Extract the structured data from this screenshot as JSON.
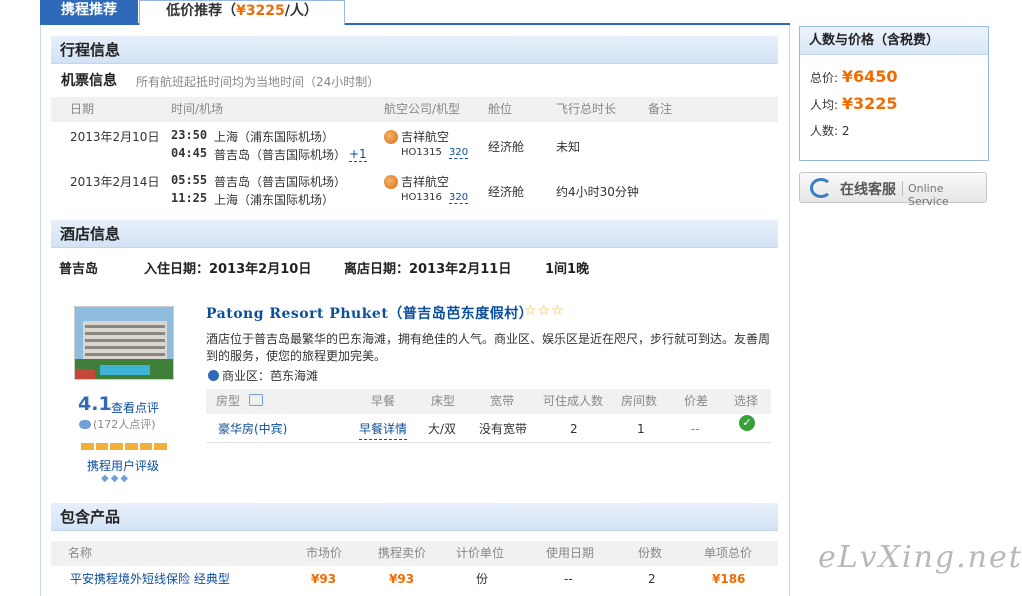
{
  "tabs": [
    {
      "label": "携程推荐"
    },
    {
      "label_prefix": "低价推荐（",
      "price": "¥3225",
      "label_suffix": "/人）"
    }
  ],
  "itinerary": {
    "title": "行程信息",
    "flight_title": "机票信息",
    "flight_note": "所有航班起抵时间均为当地时间（24小时制）",
    "headers": [
      "日期",
      "时间/机场",
      "航空公司/机型",
      "舱位",
      "飞行总时长",
      "备注"
    ],
    "flights": [
      {
        "date": "2013年2月10日",
        "dep_time": "23:50",
        "dep_airport": "上海（浦东国际机场）",
        "arr_time": "04:45",
        "arr_airport": "普吉岛（普吉国际机场）",
        "day_offset": "+1",
        "airline": "吉祥航空",
        "flight_no": "HO1315",
        "aircraft": "320",
        "cabin": "经济舱",
        "duration": "未知"
      },
      {
        "date": "2013年2月14日",
        "dep_time": "05:55",
        "dep_airport": "普吉岛（普吉国际机场）",
        "arr_time": "11:25",
        "arr_airport": "上海（浦东国际机场）",
        "day_offset": "",
        "airline": "吉祥航空",
        "flight_no": "HO1316",
        "aircraft": "320",
        "cabin": "经济舱",
        "duration": "约4小时30分钟"
      }
    ]
  },
  "hotel": {
    "title": "酒店信息",
    "city": "普吉岛",
    "checkin": "入住日期：2013年2月10日",
    "checkout": "离店日期：2013年2月11日",
    "rooms_nights": "1间1晚",
    "name": "Patong Resort Phuket（普吉岛芭东度假村）",
    "stars": "☆☆☆",
    "description": "酒店位于普吉岛最繁华的巴东海滩，拥有绝佳的人气。商业区、娱乐区是近在咫尺，步行就可到达。友善周到的服务，使您的旅程更加完美。",
    "business_area": "商业区：芭东海滩",
    "score": "4.1",
    "score_link": "查看点评",
    "review_count": "(172人点评)",
    "rating_label": "携程用户评级",
    "rating_diamonds": "◆◆◆",
    "room_headers": [
      "房型",
      "早餐",
      "床型",
      "宽带",
      "可住成人数",
      "房间数",
      "价差",
      "选择"
    ],
    "room": {
      "type": "豪华房(中宾)",
      "breakfast": "早餐详情",
      "bed": "大/双",
      "broadband": "没有宽带",
      "adults": "2",
      "rooms": "1",
      "price_diff": "--",
      "select": "✓"
    }
  },
  "products": {
    "title": "包含产品",
    "headers": [
      "名称",
      "市场价",
      "携程卖价",
      "计价单位",
      "使用日期",
      "份数",
      "单项总价"
    ],
    "rows": [
      {
        "name": "平安携程境外短线保险 经典型",
        "market_price": "¥93",
        "ctrip_price": "¥93",
        "unit": "份",
        "date": "--",
        "qty": "2",
        "total": "¥186"
      }
    ]
  },
  "side": {
    "title": "人数与价格（含税费）",
    "total_label": "总价:",
    "total_value": "¥6450",
    "avg_label": "人均:",
    "avg_value": "¥3225",
    "people_label": "人数:",
    "people_value": "2",
    "service_cn": "在线客服",
    "service_en": "Online Service"
  },
  "watermark": "eLvXing.net",
  "colors": {
    "accent": "#2f6ab8",
    "price": "#f06c00",
    "link": "#0b4f9c"
  }
}
